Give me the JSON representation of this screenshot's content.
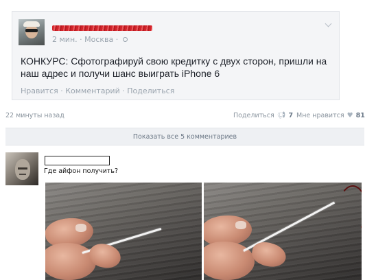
{
  "post": {
    "time": "2 мин.",
    "separator": "·",
    "location": "Москва",
    "location_suffix": "·",
    "text": "КОНКУРС: Сфотографируй свою кредитку с двух сторон, пришли на наш адрес и получи шанс выиграть iPhone 6",
    "actions": {
      "like": "Нравится",
      "comment": "Комментарий",
      "share": "Поделиться",
      "separator": "·"
    }
  },
  "meta": {
    "posted_ago": "22 минуты назад",
    "share_label": "Поделиться",
    "share_count": "7",
    "like_label": "Мне нравится",
    "like_count": "81"
  },
  "comments": {
    "show_all_label": "Показать все 5 комментариев",
    "items": [
      {
        "text": "Где айфон получить?"
      }
    ]
  },
  "icons": {
    "share": "megaphone-icon",
    "like": "heart-icon"
  },
  "colors": {
    "text_muted": "#9aa4ae",
    "counter": "#6a7887",
    "redaction": "#d2232a"
  }
}
